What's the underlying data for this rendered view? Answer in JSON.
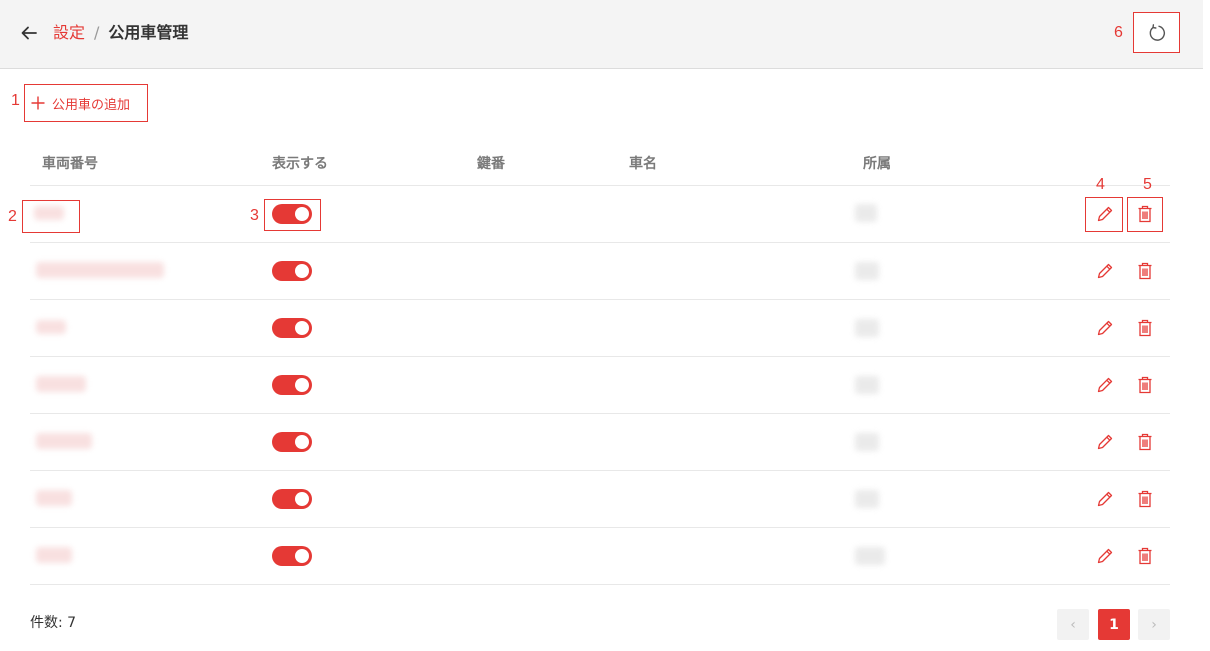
{
  "header": {
    "breadcrumb_parent": "設定",
    "breadcrumb_separator": "/",
    "breadcrumb_current": "公用車管理"
  },
  "toolbar": {
    "add_label": "公用車の追加"
  },
  "table": {
    "columns": [
      "車両番号",
      "表示する",
      "鍵番",
      "車名",
      "所属"
    ],
    "rows": [
      {
        "display": true
      },
      {
        "display": true
      },
      {
        "display": true
      },
      {
        "display": true
      },
      {
        "display": true
      },
      {
        "display": true
      },
      {
        "display": true
      }
    ]
  },
  "footer": {
    "count_label": "件数: 7",
    "pagination": {
      "prev": "‹",
      "current": "1",
      "next": "›"
    }
  },
  "annotations": [
    "1",
    "2",
    "3",
    "4",
    "5",
    "6"
  ],
  "colors": {
    "accent": "#e53935",
    "header_bg": "#f4f4f4",
    "border": "#e8e8e8"
  }
}
